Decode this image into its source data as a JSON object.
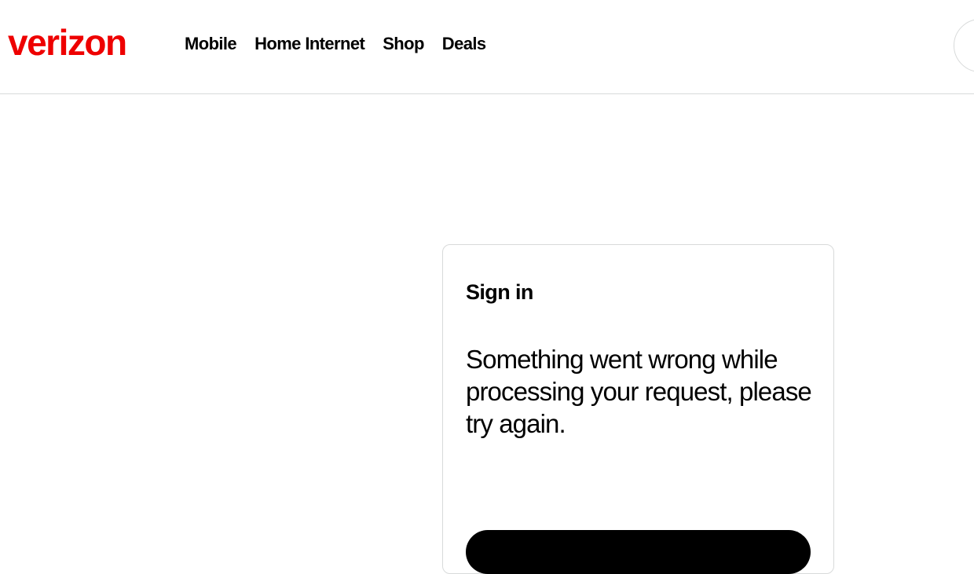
{
  "header": {
    "logo_text": "verizon",
    "nav": [
      {
        "label": "Mobile"
      },
      {
        "label": "Home Internet"
      },
      {
        "label": "Shop"
      },
      {
        "label": "Deals"
      }
    ]
  },
  "card": {
    "title": "Sign in",
    "message": "Something went wrong while processing your request, please try again."
  },
  "colors": {
    "brand": "#ee0000",
    "text": "#000000",
    "border": "#d8dada",
    "button": "#000000"
  }
}
